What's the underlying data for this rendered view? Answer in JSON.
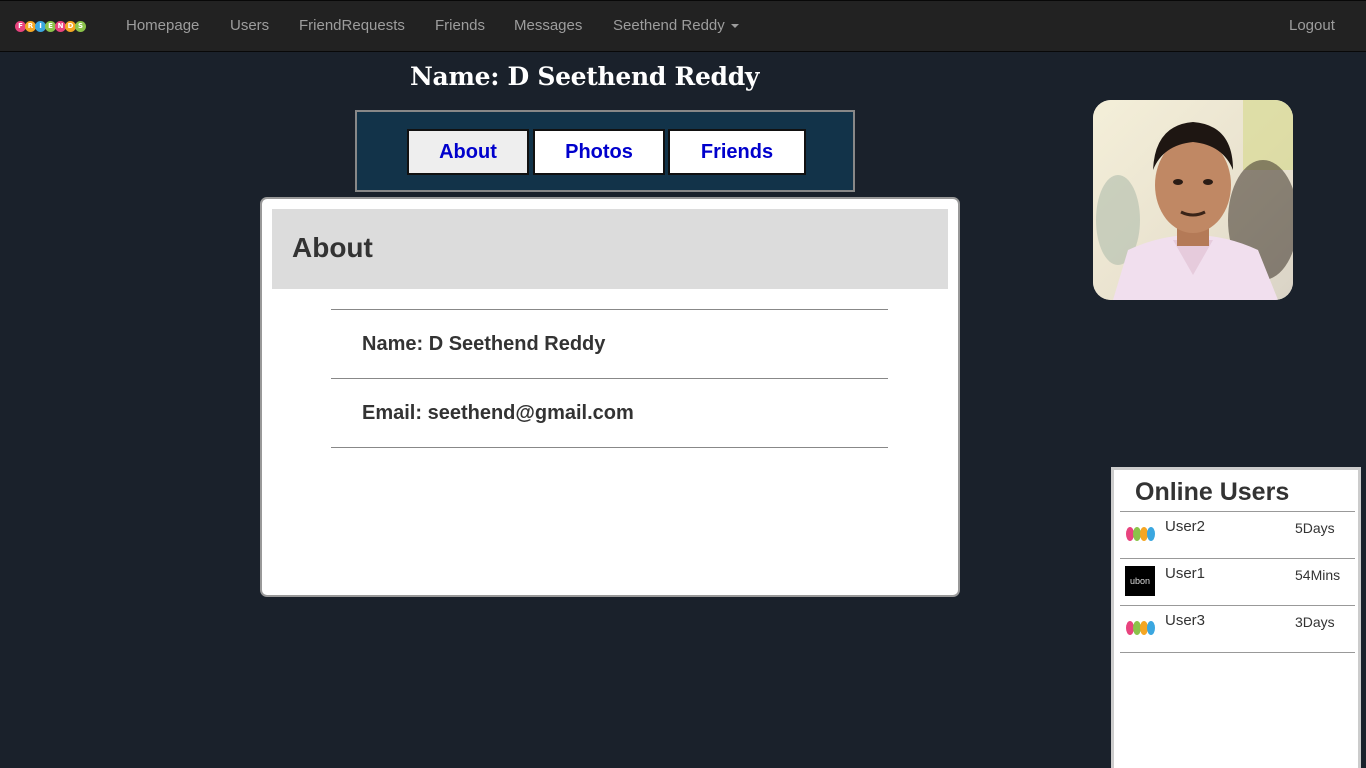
{
  "navbar": {
    "brand_letters": [
      "F",
      "R",
      "I",
      "E",
      "N",
      "D",
      "S"
    ],
    "brand_colors": [
      "#e8437e",
      "#f5a623",
      "#3ba7e0",
      "#8bc34a",
      "#e8437e",
      "#f5a623",
      "#8bc34a"
    ],
    "items": [
      {
        "label": "Homepage"
      },
      {
        "label": "Users"
      },
      {
        "label": "FriendRequests"
      },
      {
        "label": "Friends"
      },
      {
        "label": "Messages"
      },
      {
        "label": "Seethend Reddy"
      }
    ],
    "logout": "Logout"
  },
  "profile": {
    "title": "Name:  D Seethend Reddy",
    "tabs": [
      {
        "label": "About",
        "active": true
      },
      {
        "label": "Photos"
      },
      {
        "label": "Friends"
      }
    ]
  },
  "about": {
    "heading": "About",
    "name_line": "Name:  D Seethend Reddy",
    "email_line": "Email:  seethend@gmail.com"
  },
  "online_users": {
    "heading": "Online Users",
    "users": [
      {
        "name": "User2",
        "time": "5Days",
        "avatar": "friends-logo"
      },
      {
        "name": "User1",
        "time": "54Mins",
        "avatar": "ubon-logo",
        "avatar_text": "ubon"
      },
      {
        "name": "User3",
        "time": "3Days",
        "avatar": "friends-logo"
      }
    ]
  },
  "colors": {
    "page_bg": "#1a212b",
    "navbar_bg": "#222222",
    "tabbar_bg": "#123349",
    "tab_text": "#0000cc"
  }
}
